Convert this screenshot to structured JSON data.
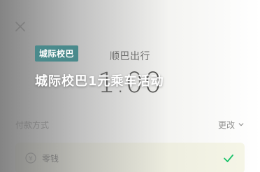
{
  "dialog": {
    "merchant_name": "顺巴出行",
    "amount": "1.00",
    "payment_method_label": "付款方式",
    "change_label": "更改",
    "wallet_option": "零钱"
  },
  "overlay": {
    "badge": "城际校巴",
    "headline": "城际校巴1元乘车活动"
  },
  "colors": {
    "badge_bg": "#4a8a8c",
    "check_green": "#07c160"
  },
  "icons": {
    "close": "close-icon",
    "change": "chevron-down-icon",
    "wallet": "coin-icon",
    "check": "check-icon"
  }
}
